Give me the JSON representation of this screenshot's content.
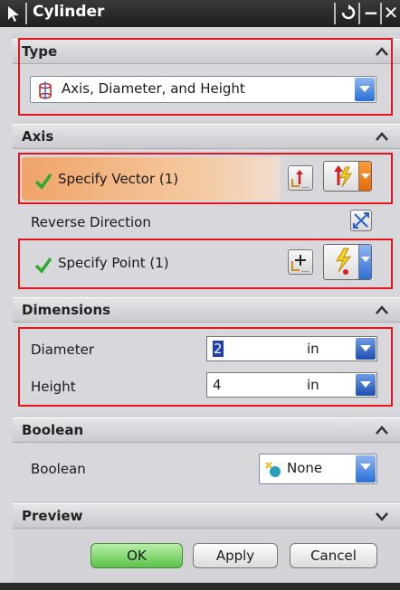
{
  "window": {
    "title": "Cylinder",
    "reset_icon": "reset-icon",
    "minimize_icon": "minimize-icon",
    "close_icon": "close-icon"
  },
  "sections": {
    "type": {
      "header": "Type",
      "dropdown_value": "Axis, Diameter, and Height"
    },
    "axis": {
      "header": "Axis",
      "specify_vector": {
        "label": "Specify Vector (1)",
        "status": "complete"
      },
      "reverse_direction_label": "Reverse Direction",
      "specify_point": {
        "label": "Specify Point (1)",
        "status": "complete"
      }
    },
    "dimensions": {
      "header": "Dimensions",
      "diameter": {
        "label": "Diameter",
        "value": "2",
        "unit": "in"
      },
      "height": {
        "label": "Height",
        "value": "4",
        "unit": "in"
      }
    },
    "boolean": {
      "header": "Boolean",
      "label": "Boolean",
      "value": "None"
    },
    "preview": {
      "header": "Preview"
    }
  },
  "buttons": {
    "ok": "OK",
    "apply": "Apply",
    "cancel": "Cancel"
  },
  "colors": {
    "highlight_box": "#e4161b",
    "vector_row": "#efa76c",
    "check": "#2eab2e",
    "ok_button": "#6fce5c"
  }
}
